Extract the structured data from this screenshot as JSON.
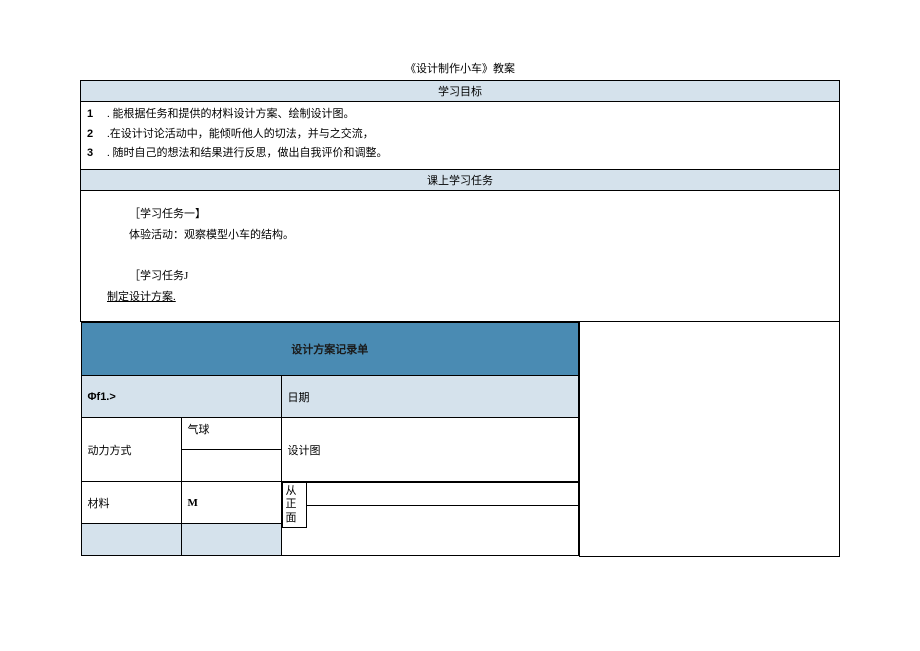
{
  "title": "《设计制作小车》教案",
  "sections": {
    "goals_header": "学习目标",
    "tasks_header": "课上学习任务"
  },
  "goals": [
    {
      "num": "1",
      "text": ". 能根据任务和提供的材料设计方案、绘制设计图。"
    },
    {
      "num": "2",
      "text": ".在设计讨论活动中，能倾听他人的切法，并与之交流，"
    },
    {
      "num": "3",
      "text": ". 随时自己的想法和结果进行反思，做出自我评价和调整。"
    }
  ],
  "tasks": {
    "task1_label": "［学习任务一】",
    "task1_body": "体验活动：观察模型小车的结构。",
    "task2_label": "［学习任务J",
    "task2_body": "制定设计方案."
  },
  "record": {
    "title": "设计方案记录单",
    "row1_left": "Φf1.>",
    "row1_right": "日期",
    "row2_left": "动力方式",
    "row2_mid_top": "气球",
    "row2_right": "设计图",
    "row3_left": "材料",
    "row3_mid": "M",
    "row3_right": "从正面"
  }
}
